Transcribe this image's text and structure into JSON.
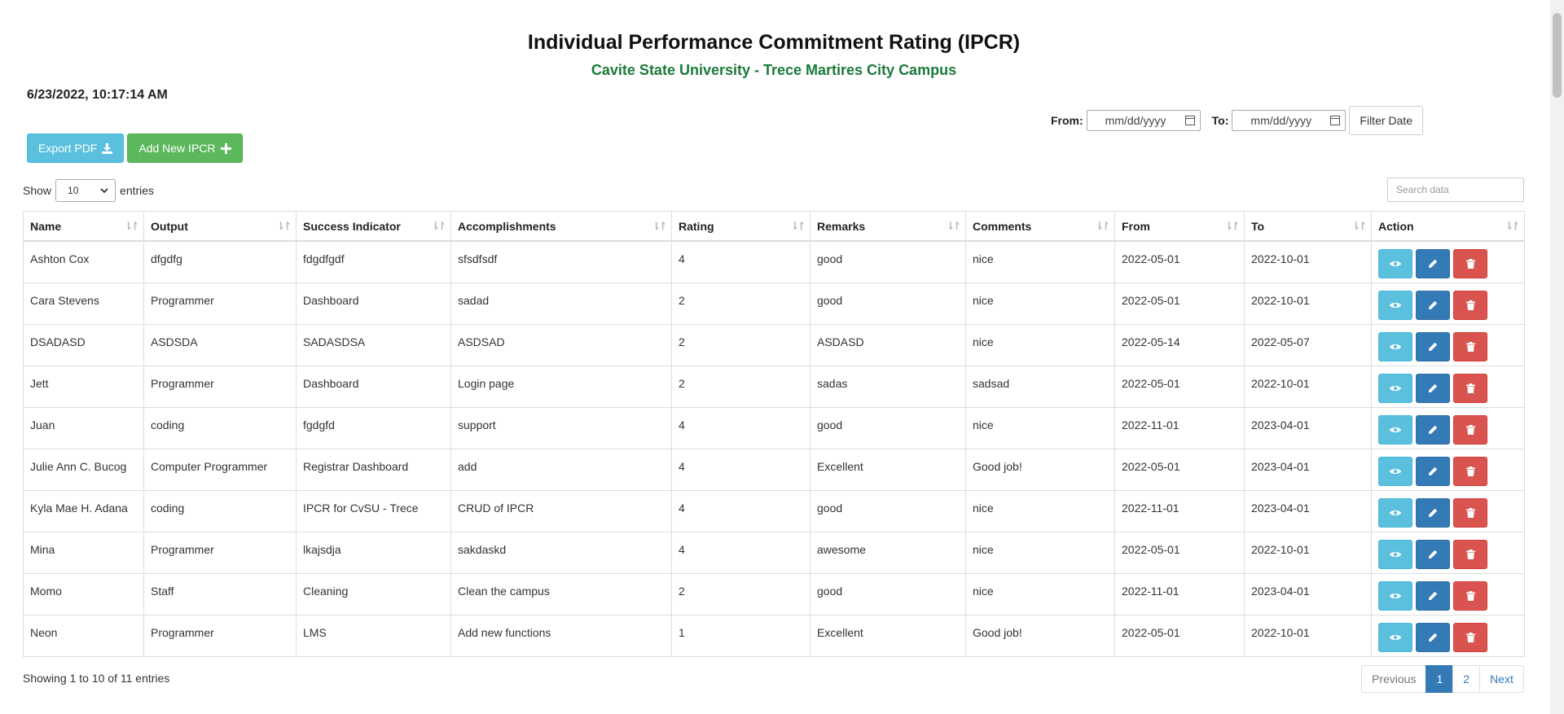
{
  "header": {
    "title": "Individual Performance Commitment Rating (IPCR)",
    "subtitle": "Cavite State University - Trece Martires City Campus",
    "datetime": "6/23/2022, 10:17:14 AM"
  },
  "filter": {
    "from_label": "From:",
    "to_label": "To:",
    "from_placeholder": "mm/dd/yyyy",
    "to_placeholder": "mm/dd/yyyy",
    "button_label": "Filter Date"
  },
  "toolbar": {
    "export_label": "Export PDF",
    "add_label": "Add New IPCR"
  },
  "length": {
    "show_label": "Show",
    "value": "10",
    "entries_label": "entries"
  },
  "search": {
    "placeholder": "Search data"
  },
  "table": {
    "columns": [
      "Name",
      "Output",
      "Success Indicator",
      "Accomplishments",
      "Rating",
      "Remarks",
      "Comments",
      "From",
      "To",
      "Action"
    ],
    "rows": [
      [
        "Ashton Cox",
        "dfgdfg",
        "fdgdfgdf",
        "sfsdfsdf",
        "4",
        "good",
        "nice",
        "2022-05-01",
        "2022-10-01"
      ],
      [
        "Cara Stevens",
        "Programmer",
        "Dashboard",
        "sadad",
        "2",
        "good",
        "nice",
        "2022-05-01",
        "2022-10-01"
      ],
      [
        "DSADASD",
        "ASDSDA",
        "SADASDSA",
        "ASDSAD",
        "2",
        "ASDASD",
        "nice",
        "2022-05-14",
        "2022-05-07"
      ],
      [
        "Jett",
        "Programmer",
        "Dashboard",
        "Login page",
        "2",
        "sadas",
        "sadsad",
        "2022-05-01",
        "2022-10-01"
      ],
      [
        "Juan",
        "coding",
        "fgdgfd",
        "support",
        "4",
        "good",
        "nice",
        "2022-11-01",
        "2023-04-01"
      ],
      [
        "Julie Ann C. Bucog",
        "Computer Programmer",
        "Registrar Dashboard",
        "add",
        "4",
        "Excellent",
        "Good job!",
        "2022-05-01",
        "2023-04-01"
      ],
      [
        "Kyla Mae H. Adana",
        "coding",
        "IPCR for CvSU - Trece",
        "CRUD of IPCR",
        "4",
        "good",
        "nice",
        "2022-11-01",
        "2023-04-01"
      ],
      [
        "Mina",
        "Programmer",
        "lkajsdja",
        "sakdaskd",
        "4",
        "awesome",
        "nice",
        "2022-05-01",
        "2022-10-01"
      ],
      [
        "Momo",
        "Staff",
        "Cleaning",
        "Clean the campus",
        "2",
        "good",
        "nice",
        "2022-11-01",
        "2023-04-01"
      ],
      [
        "Neon",
        "Programmer",
        "LMS",
        "Add new functions",
        "1",
        "Excellent",
        "Good job!",
        "2022-05-01",
        "2022-10-01"
      ]
    ]
  },
  "footer": {
    "info": "Showing 1 to 10 of 11 entries",
    "pagination": {
      "previous": "Previous",
      "pages": [
        "1",
        "2"
      ],
      "next": "Next"
    }
  },
  "colors": {
    "subtitle": "#1b7a3a",
    "view": "#5bc0de",
    "edit": "#337ab7",
    "delete": "#d9534f",
    "add": "#5cb85c"
  },
  "icons": {
    "export": "download-icon",
    "add": "plus-icon",
    "view": "eye-icon",
    "edit": "pencil-icon",
    "delete": "trash-icon",
    "sort": "sort-icon",
    "calendar": "calendar-icon"
  }
}
